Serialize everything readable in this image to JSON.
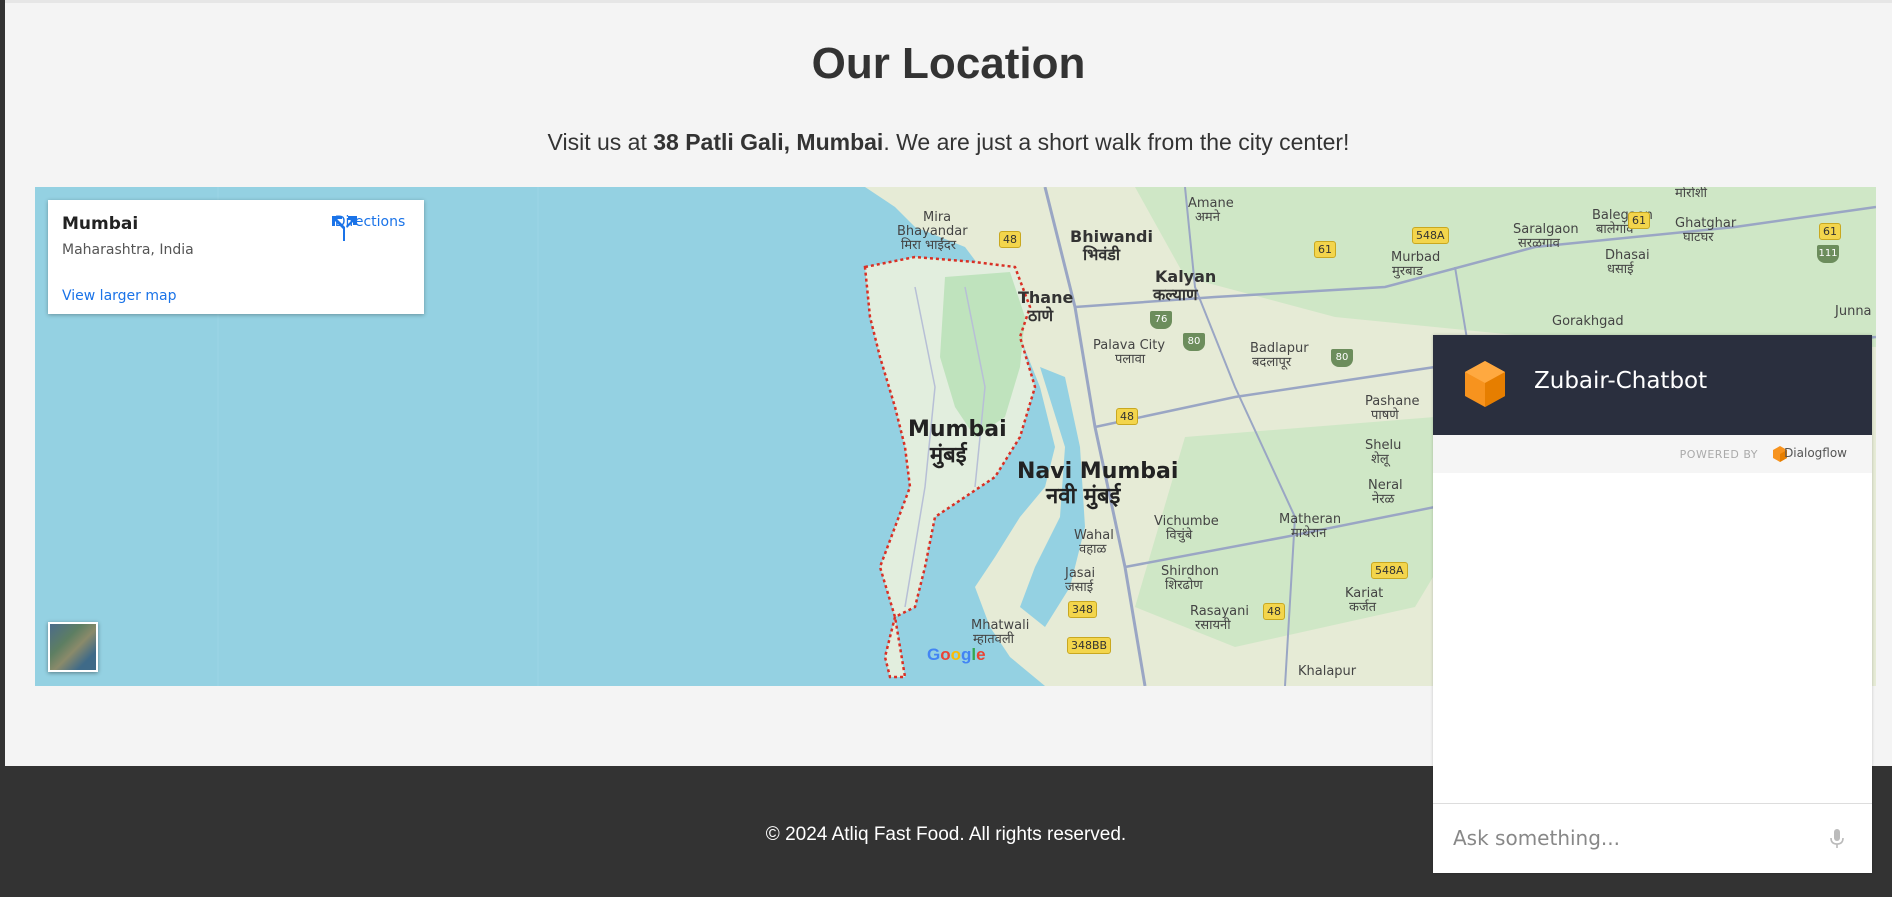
{
  "section": {
    "title": "Our Location",
    "subtitle_before": "Visit us at ",
    "subtitle_bold": "38 Patli Gali, Mumbai",
    "subtitle_after": ". We are just a short walk from the city center!"
  },
  "map": {
    "card": {
      "place_name": "Mumbai",
      "place_region": "Maharashtra, India",
      "view_larger": "View larger map",
      "directions": "Directions"
    },
    "labels": {
      "mumbai_en": "Mumbai",
      "mumbai_mr": "मुंबई",
      "navi_mumbai_en": "Navi Mumbai",
      "navi_mumbai_mr": "नवी मुंबई",
      "thane_en": "Thane",
      "thane_mr": "ठाणे",
      "bhiwandi_en": "Bhiwandi",
      "bhiwandi_mr": "भिवंडी",
      "kalyan_en": "Kalyan",
      "kalyan_mr": "कल्याण",
      "mira_en": "Mira",
      "bhayandar_en": "Bhayandar",
      "mira_mr": "मिरा भाईंदर",
      "amane_en": "Amane",
      "amane_mr": "अमने",
      "palava_en": "Palava City",
      "palava_mr": "पलावा",
      "badlapur_en": "Badlapur",
      "badlapur_mr": "बदलापूर",
      "murbad_en": "Murbad",
      "murbad_mr": "मुरबाड",
      "saralgaon_en": "Saralgaon",
      "saralgaon_mr": "सरळगाव",
      "balegaon_en": "Balegaon",
      "balegaon_mr": "बालेगांव",
      "dhasai_en": "Dhasai",
      "dhasai_mr": "धसाई",
      "ghatghar_en": "Ghatghar",
      "ghatghar_mr": "घाटघर",
      "gorakhgad_en": "Gorakhgad",
      "junnar_en": "Junna",
      "morshi_mr": "मोरोशी",
      "pashane_en": "Pashane",
      "pashane_mr": "पाषणे",
      "shelu_en": "Shelu",
      "shelu_mr": "शेलू",
      "neral_en": "Neral",
      "neral_mr": "नेरळ",
      "matheran_en": "Matheran",
      "matheran_mr": "माथेरान",
      "vichumbe_en": "Vichumbe",
      "vichumbe_mr": "विचुंबे",
      "wahal_en": "Wahal",
      "wahal_mr": "वहाळ",
      "jasai_en": "Jasai",
      "jasai_mr": "जसाई",
      "shirdhon_en": "Shirdhon",
      "shirdhon_mr": "शिरढोण",
      "rasayani_en": "Rasayani",
      "rasayani_mr": "रसायनी",
      "karjat_en": "Kariat",
      "karjat_mr": "कर्जत",
      "mhatwali_en": "Mhatwali",
      "mhatwali_mr": "म्हातवली",
      "khalapur_en": "Khalapur"
    },
    "highways": [
      "48",
      "61",
      "548A",
      "61",
      "61",
      "48",
      "348",
      "348BB",
      "48",
      "548A"
    ],
    "national_highways": [
      "76",
      "80",
      "80",
      "111"
    ],
    "google": [
      "G",
      "o",
      "o",
      "g",
      "l",
      "e"
    ]
  },
  "footer": {
    "copyright": "© 2024 Atliq Fast Food. All rights reserved."
  },
  "chatbot": {
    "title": "Zubair-Chatbot",
    "powered_by": "POWERED BY",
    "provider": "Dialogflow",
    "input_placeholder": "Ask something..."
  },
  "colors": {
    "water": "#94d1e2",
    "land": "#e8ecd9",
    "green": "#c4e6c0",
    "chat_header": "#2a2f3e",
    "link": "#1a73e8",
    "footer": "#333333",
    "section_bg": "#f4f4f4"
  },
  "icons": {
    "directions": "directions-icon",
    "mic": "microphone-icon",
    "dialogflow": "dialogflow-logo-icon"
  }
}
